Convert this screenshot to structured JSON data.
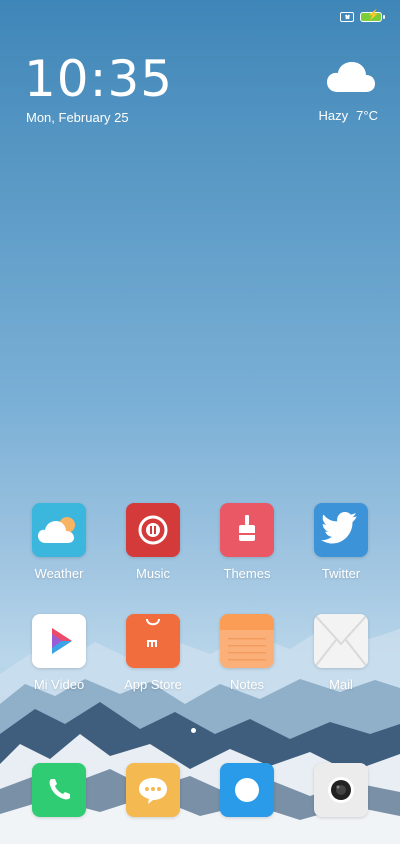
{
  "status_bar": {
    "sim_icon": "sim-x-icon",
    "battery_icon": "battery-charging-icon",
    "battery_color": "#7ccd3a"
  },
  "clock": {
    "time": "10:35",
    "date": "Mon, February 25"
  },
  "weather": {
    "condition": "Hazy",
    "temperature": "7°C",
    "icon": "cloud-icon"
  },
  "apps": {
    "weather": {
      "label": "Weather",
      "icon": "weather-app-icon",
      "color": "#3bb6dc"
    },
    "music": {
      "label": "Music",
      "icon": "music-app-icon",
      "color": "#d53a3a"
    },
    "themes": {
      "label": "Themes",
      "icon": "themes-app-icon",
      "color": "#ea5866"
    },
    "twitter": {
      "label": "Twitter",
      "icon": "twitter-app-icon",
      "color": "#3d93d8"
    },
    "mi_video": {
      "label": "Mi Video",
      "icon": "mi-video-app-icon",
      "color": "#ffffff"
    },
    "app_store": {
      "label": "App Store",
      "icon": "app-store-icon",
      "color": "#f26d3d"
    },
    "notes": {
      "label": "Notes",
      "icon": "notes-app-icon",
      "color": "#fbb079"
    },
    "mail": {
      "label": "Mail",
      "icon": "mail-app-icon",
      "color": "#f3f3f3"
    }
  },
  "dock": {
    "phone": {
      "icon": "phone-app-icon",
      "color": "#2fcc74"
    },
    "messages": {
      "icon": "messages-app-icon",
      "color": "#f5b951"
    },
    "browser": {
      "icon": "browser-app-icon",
      "color": "#2a9be8"
    },
    "camera": {
      "icon": "camera-app-icon",
      "color": "#ececec"
    }
  },
  "page_indicator": {
    "pages": 1,
    "current": 1
  }
}
